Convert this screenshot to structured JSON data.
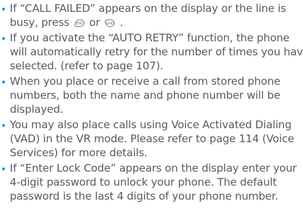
{
  "bullets": [
    {
      "lines": [
        "If “CALL FAILED” appears on the display or the line is",
        "busy, press",
        "or",
        "."
      ],
      "icons": [
        "end-key-icon",
        "send-key-icon"
      ]
    },
    {
      "lines": [
        "If you activate the “AUTO RETRY” function, the phone",
        "will automatically retry for the number of times you have",
        "selected. (refer to page 107)."
      ]
    },
    {
      "lines": [
        "When you place or receive a call from stored phone",
        "numbers, both the name and phone number will be",
        "displayed."
      ]
    },
    {
      "lines": [
        "You may also place calls using Voice Activated Dialing",
        "(VAD) in the VR mode. Please refer to page 114 (Voice",
        "Services) for more details."
      ]
    },
    {
      "lines": [
        "If “Enter Lock Code” appears on the display enter your",
        "4-digit password to unlock your phone. The default",
        "password is the last 4 digits of your phone number."
      ]
    }
  ],
  "colors": {
    "bullet": "#1f8fd6",
    "text": "#555b60"
  }
}
